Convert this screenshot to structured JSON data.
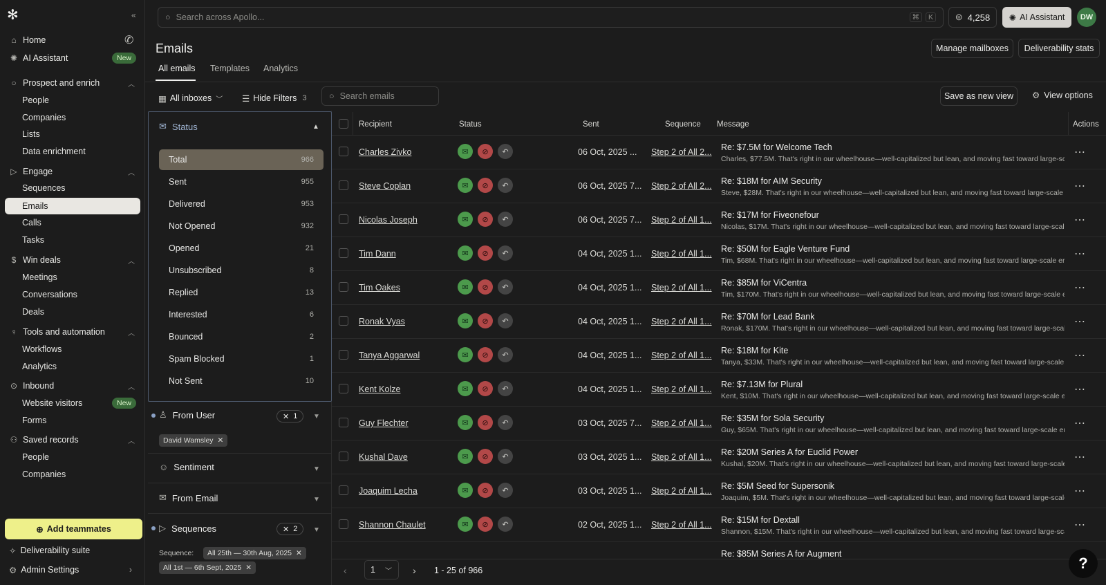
{
  "sidebar": {
    "home": "Home",
    "ai_assistant": "AI Assistant",
    "new_badge": "New",
    "prospect": "Prospect and enrich",
    "people": "People",
    "companies": "Companies",
    "lists": "Lists",
    "data_enrichment": "Data enrichment",
    "engage": "Engage",
    "sequences": "Sequences",
    "emails": "Emails",
    "calls": "Calls",
    "tasks": "Tasks",
    "win_deals": "Win deals",
    "meetings": "Meetings",
    "conversations": "Conversations",
    "deals": "Deals",
    "tools": "Tools and automation",
    "workflows": "Workflows",
    "analytics": "Analytics",
    "inbound": "Inbound",
    "website_visitors": "Website visitors",
    "forms": "Forms",
    "saved_records": "Saved records",
    "saved_people": "People",
    "saved_companies": "Companies",
    "add_teammates": "Add teammates",
    "deliverability_suite": "Deliverability suite",
    "admin_settings": "Admin Settings"
  },
  "topbar": {
    "search_placeholder": "Search across Apollo...",
    "kbd_cmd": "⌘",
    "kbd_k": "K",
    "credits": "4,258",
    "ai_assistant": "AI Assistant",
    "avatar_initials": "DW"
  },
  "page": {
    "title": "Emails",
    "tabs": [
      "All emails",
      "Templates",
      "Analytics"
    ],
    "manage_mailboxes": "Manage mailboxes",
    "deliverability_stats": "Deliverability stats"
  },
  "toolbar": {
    "all_inboxes": "All inboxes",
    "hide_filters": "Hide Filters",
    "filter_count": "3",
    "search_placeholder": "Search emails",
    "save_view": "Save as new view",
    "view_options": "View options"
  },
  "filters": {
    "status_title": "Status",
    "status_rows": [
      {
        "label": "Total",
        "count": "966"
      },
      {
        "label": "Sent",
        "count": "955"
      },
      {
        "label": "Delivered",
        "count": "953"
      },
      {
        "label": "Not Opened",
        "count": "932"
      },
      {
        "label": "Opened",
        "count": "21"
      },
      {
        "label": "Unsubscribed",
        "count": "8"
      },
      {
        "label": "Replied",
        "count": "13"
      },
      {
        "label": "Interested",
        "count": "6"
      },
      {
        "label": "Bounced",
        "count": "2"
      },
      {
        "label": "Spam Blocked",
        "count": "1"
      },
      {
        "label": "Not Sent",
        "count": "10"
      }
    ],
    "from_user": "From User",
    "from_user_count": "1",
    "from_user_chip": "David Wamsley",
    "sentiment": "Sentiment",
    "from_email": "From Email",
    "sequences": "Sequences",
    "sequences_count": "2",
    "sequence_label": "Sequence:",
    "sequence_chip_1": "All 25th — 30th Aug, 2025",
    "sequence_chip_2": "All 1st — 6th Sept, 2025"
  },
  "table": {
    "headers": {
      "recipient": "Recipient",
      "status": "Status",
      "sent": "Sent",
      "sequence": "Sequence",
      "message": "Message",
      "actions": "Actions"
    },
    "rows": [
      {
        "recipient": "Charles Zivko",
        "sent": "06 Oct, 2025 ...",
        "sequence": "Step 2 of All 2...",
        "title": "Re: $7.5M for Welcome Tech",
        "preview": "Charles, $77.5M. That's right in our wheelhouse—well-capitalized but lean, and moving fast toward large-scale"
      },
      {
        "recipient": "Steve Coplan",
        "sent": "06 Oct, 2025 7...",
        "sequence": "Step 2 of All 2...",
        "title": "Re: $18M for AIM Security",
        "preview": "Steve, $28M. That's right in our wheelhouse—well-capitalized but lean, and moving fast toward large-scale"
      },
      {
        "recipient": "Nicolas Joseph",
        "sent": "06 Oct, 2025 7...",
        "sequence": "Step 2 of All 1...",
        "title": "Re: $17M for Fiveonefour",
        "preview": "Nicolas, $17M. That's right in our wheelhouse—well-capitalized but lean, and moving fast toward large-scale"
      },
      {
        "recipient": "Tim Dann",
        "sent": "04 Oct, 2025 1...",
        "sequence": "Step 2 of All 1...",
        "title": "Re: $50M for Eagle Venture Fund",
        "preview": "Tim, $68M. That's right in our wheelhouse—well-capitalized but lean, and moving fast toward large-scale er"
      },
      {
        "recipient": "Tim Oakes",
        "sent": "04 Oct, 2025 1...",
        "sequence": "Step 2 of All 1...",
        "title": "Re: $85M for ViCentra",
        "preview": "Tim, $170M. That's right in our wheelhouse—well-capitalized but lean, and moving fast toward large-scale e"
      },
      {
        "recipient": "Ronak Vyas",
        "sent": "04 Oct, 2025 1...",
        "sequence": "Step 2 of All 1...",
        "title": "Re: $70M for Lead Bank",
        "preview": "Ronak, $170M. That's right in our wheelhouse—well-capitalized but lean, and moving fast toward large-scale"
      },
      {
        "recipient": "Tanya Aggarwal",
        "sent": "04 Oct, 2025 1...",
        "sequence": "Step 2 of All 1...",
        "title": "Re: $18M for Kite",
        "preview": "Tanya, $33M. That's right in our wheelhouse—well-capitalized but lean, and moving fast toward large-scale"
      },
      {
        "recipient": "Kent Kolze",
        "sent": "04 Oct, 2025 1...",
        "sequence": "Step 2 of All 1...",
        "title": "Re: $7.13M for Plural",
        "preview": "Kent, $10M. That's right in our wheelhouse—well-capitalized but lean, and moving fast toward large-scale en"
      },
      {
        "recipient": "Guy Flechter",
        "sent": "03 Oct, 2025 7...",
        "sequence": "Step 2 of All 1...",
        "title": "Re: $35M for Sola Security",
        "preview": "Guy, $65M. That's right in our wheelhouse—well-capitalized but lean, and moving fast toward large-scale en"
      },
      {
        "recipient": "Kushal Dave",
        "sent": "03 Oct, 2025 1...",
        "sequence": "Step 2 of All 1...",
        "title": "Re: $20M Series A for Euclid Power",
        "preview": "Kushal, $20M. That's right in our wheelhouse—well-capitalized but lean, and moving fast toward large-scale"
      },
      {
        "recipient": "Joaquim Lecha",
        "sent": "03 Oct, 2025 1...",
        "sequence": "Step 2 of All 1...",
        "title": "Re: $5M Seed for Supersonik",
        "preview": "Joaquim, $5M. That's right in our wheelhouse—well-capitalized but lean, and moving fast toward large-scale"
      },
      {
        "recipient": "Shannon Chaulet",
        "sent": "02 Oct, 2025 1...",
        "sequence": "Step 2 of All 1...",
        "title": "Re: $15M for Dextall",
        "preview": "Shannon, $15M. That's right in our wheelhouse—well-capitalized but lean, and moving fast toward large-scale"
      },
      {
        "recipient": "",
        "sent": "",
        "sequence": "",
        "title": "Re: $85M Series A for Augment",
        "preview": ""
      }
    ]
  },
  "pagination": {
    "page": "1",
    "range": "1 - 25 of 966"
  },
  "help": "?"
}
